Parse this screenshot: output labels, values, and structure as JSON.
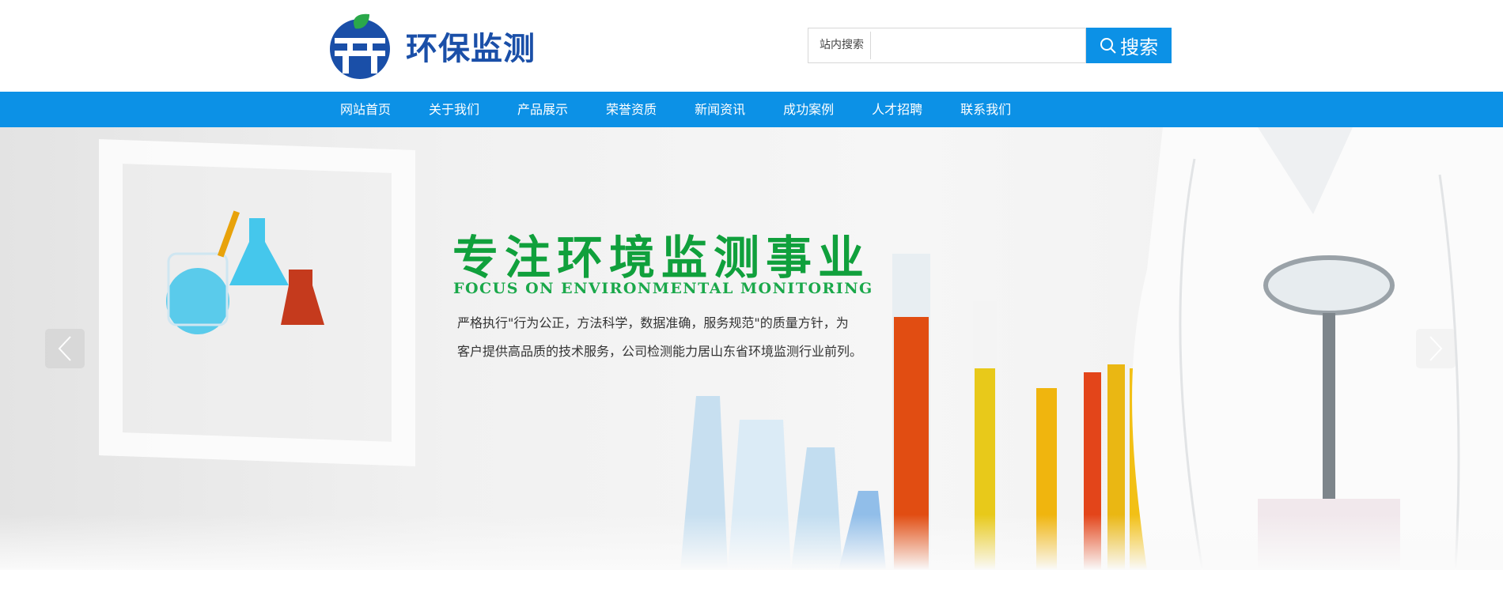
{
  "header": {
    "logo_text": "环保监测",
    "search": {
      "label": "站内搜索",
      "placeholder": "",
      "button_label": "搜索"
    }
  },
  "nav": {
    "items": [
      {
        "label": "网站首页"
      },
      {
        "label": "关于我们"
      },
      {
        "label": "产品展示"
      },
      {
        "label": "荣誉资质"
      },
      {
        "label": "新闻资讯"
      },
      {
        "label": "成功案例"
      },
      {
        "label": "人才招聘"
      },
      {
        "label": "联系我们"
      }
    ]
  },
  "banner": {
    "headline": "专注环境监测事业",
    "subline": "FOCUS ON ENVIRONMENTAL MONITORING",
    "desc_line1": "严格执行\"行为公正，方法科学，数据准确，服务规范\"的质量方针，为",
    "desc_line2": "客户提供高品质的技术服务，公司检测能力居山东省环境监测行业前列。",
    "prev_icon": "chevron-left-icon",
    "next_icon": "chevron-right-icon"
  },
  "colors": {
    "nav_bg": "#0c91e6",
    "headline_green": "#10a03c",
    "logo_blue": "#1a4fa8"
  }
}
